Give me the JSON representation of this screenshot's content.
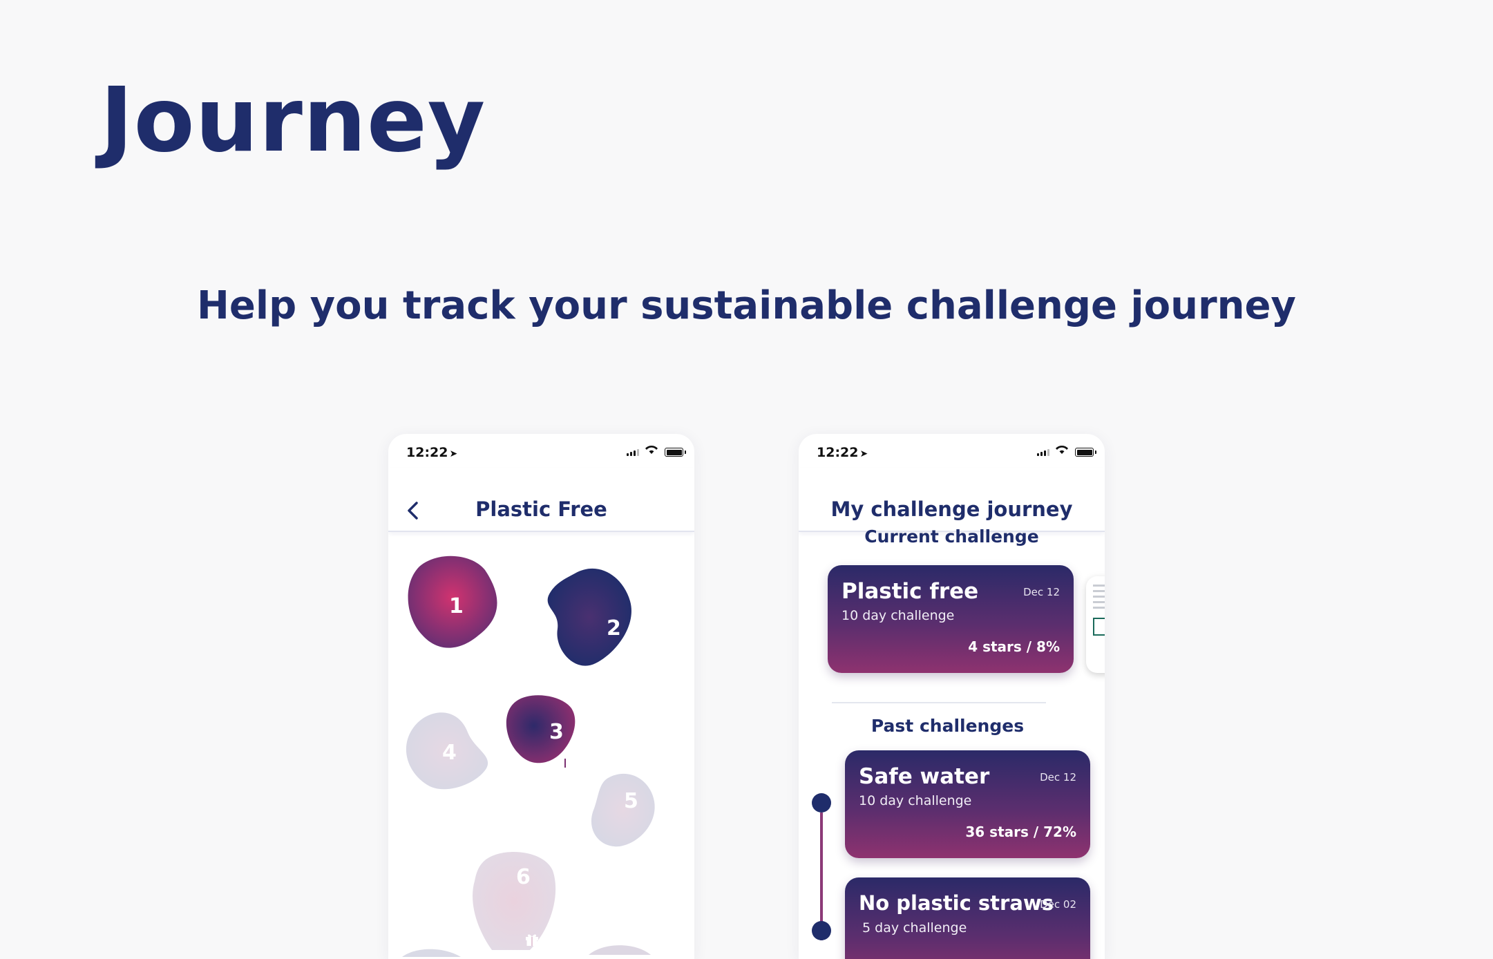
{
  "page": {
    "title": "Journey",
    "subtitle": "Help you track your sustainable challenge journey"
  },
  "colors": {
    "brand_navy": "#1f2d6b",
    "brand_plum": "#8e326f",
    "blob_inactive": "#d9dae6"
  },
  "left_phone": {
    "status": {
      "time": "12:22",
      "location_icon": "location-arrow-icon"
    },
    "nav": {
      "title": "Plastic Free",
      "back_icon": "chevron-left-icon"
    },
    "steps": [
      {
        "label": "1",
        "state": "active"
      },
      {
        "label": "2",
        "state": "active"
      },
      {
        "label": "3",
        "state": "current",
        "reward_icon": "gift-icon"
      },
      {
        "label": "4",
        "state": "locked"
      },
      {
        "label": "5",
        "state": "locked"
      },
      {
        "label": "6",
        "state": "locked",
        "reward_icon": "gift-icon"
      }
    ]
  },
  "right_phone": {
    "status": {
      "time": "12:22",
      "location_icon": "location-arrow-icon"
    },
    "nav": {
      "title": "My challenge journey"
    },
    "current_heading": "Current challenge",
    "current": {
      "title": "Plastic free",
      "date": "Dec 12",
      "subtitle": "10 day challenge",
      "stats": "4 stars / 8%"
    },
    "past_heading": "Past challenges",
    "past": [
      {
        "title": "Safe water",
        "date": "Dec 12",
        "subtitle": "10 day challenge",
        "stats": "36 stars / 72%"
      },
      {
        "title": "No plastic straws",
        "date": "Dec 02",
        "subtitle": "5 day challenge",
        "stats": ""
      }
    ]
  }
}
